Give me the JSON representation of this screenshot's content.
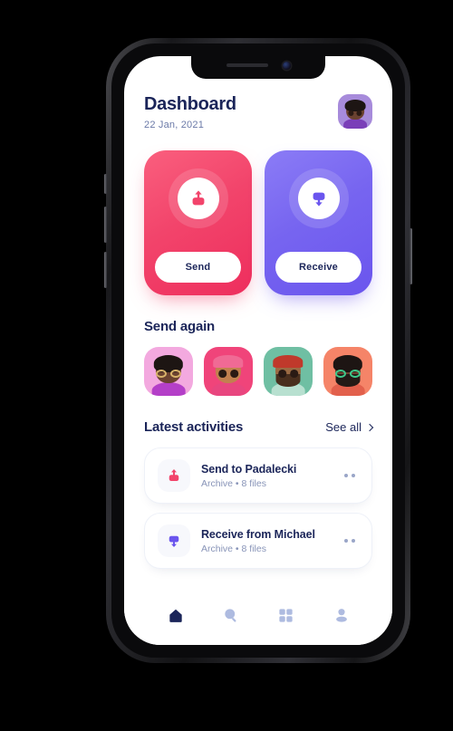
{
  "header": {
    "title": "Dashboard",
    "date": "22 Jan, 2021",
    "avatar_name": "user-avatar"
  },
  "actions": [
    {
      "id": "send",
      "label": "Send",
      "icon": "upload-icon",
      "color": "#f2446b"
    },
    {
      "id": "receive",
      "label": "Receive",
      "icon": "download-icon",
      "color": "#7765f0"
    }
  ],
  "send_again": {
    "title": "Send again",
    "contacts": [
      {
        "name": "contact-1",
        "bg": "#f3a9df",
        "skin": "#6b4230",
        "hair": "#1d1513",
        "shirt": "#b43fc8",
        "accessory": "glasses",
        "accessory_color": "#d8b36a"
      },
      {
        "name": "contact-2",
        "bg": "#f0447a",
        "skin": "#c2804f",
        "hair": "#f06a95",
        "shirt": "#e8467f",
        "accessory": "cap",
        "accessory_color": "#f06a95"
      },
      {
        "name": "contact-3",
        "bg": "#6fbfa3",
        "skin": "#9b6a43",
        "hair": "#c0392b",
        "shirt": "#b8e0d0",
        "accessory": "beanie",
        "accessory_color": "#c0392b"
      },
      {
        "name": "contact-4",
        "bg": "#f58468",
        "skin": "#6b4230",
        "hair": "#1d1513",
        "shirt": "#e2604c",
        "accessory": "glasses",
        "accessory_color": "#3ec98a"
      }
    ]
  },
  "latest_activities": {
    "title": "Latest activities",
    "see_all_label": "See all",
    "items": [
      {
        "title": "Send to Padalecki",
        "meta": "Archive  •  8 files",
        "icon": "upload-icon",
        "color": "#f2446b"
      },
      {
        "title": "Receive from Michael",
        "meta": "Archive  •  8 files",
        "icon": "download-icon",
        "color": "#6a55ee"
      }
    ]
  },
  "bottom_nav": {
    "items": [
      {
        "name": "nav-home",
        "icon": "home-icon",
        "active": true
      },
      {
        "name": "nav-search",
        "icon": "search-icon",
        "active": false
      },
      {
        "name": "nav-grid",
        "icon": "grid-icon",
        "active": false
      },
      {
        "name": "nav-profile",
        "icon": "profile-icon",
        "active": false
      }
    ],
    "active_color": "#1b2559",
    "inactive_color": "#aebbe0"
  }
}
